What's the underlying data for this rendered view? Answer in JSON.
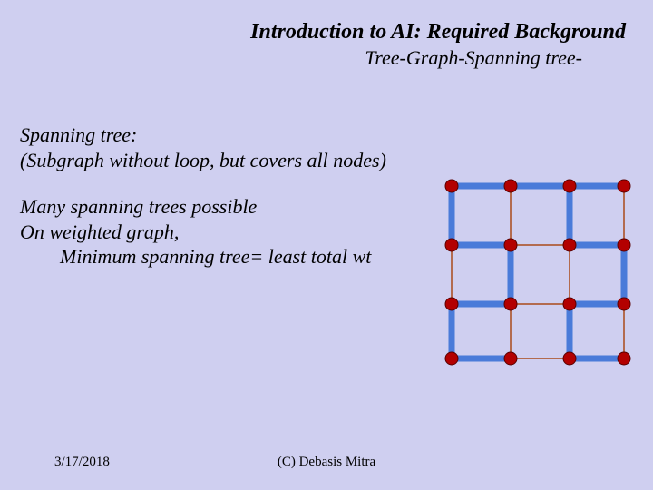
{
  "title": {
    "line1": "Introduction to AI: Required Background",
    "line2": "Tree-Graph-Spanning tree-"
  },
  "content": {
    "line1": "Spanning tree:",
    "line2": "(Subgraph without loop, but covers all nodes)",
    "line3": "Many spanning trees possible",
    "line4": "On weighted graph,",
    "line5": "Minimum spanning tree= least total wt"
  },
  "footer": {
    "date": "3/17/2018",
    "copyright": "(C) Debasis Mitra"
  },
  "graph": {
    "grid_color": "#b36b4f",
    "tree_color": "#4a7bd9",
    "node_fill": "#b30000",
    "node_stroke": "#5a0000",
    "cols": [
      10,
      75,
      140,
      200
    ],
    "rows": [
      10,
      75,
      140,
      200
    ],
    "tree_edges": [
      [
        0,
        0,
        1,
        0
      ],
      [
        1,
        0,
        2,
        0
      ],
      [
        2,
        0,
        3,
        0
      ],
      [
        0,
        0,
        0,
        1
      ],
      [
        2,
        0,
        2,
        1
      ],
      [
        0,
        1,
        1,
        1
      ],
      [
        2,
        1,
        3,
        1
      ],
      [
        1,
        1,
        1,
        2
      ],
      [
        3,
        1,
        3,
        2
      ],
      [
        0,
        2,
        1,
        2
      ],
      [
        2,
        2,
        3,
        2
      ],
      [
        0,
        2,
        0,
        3
      ],
      [
        2,
        2,
        2,
        3
      ],
      [
        0,
        3,
        1,
        3
      ],
      [
        2,
        3,
        3,
        3
      ]
    ]
  }
}
